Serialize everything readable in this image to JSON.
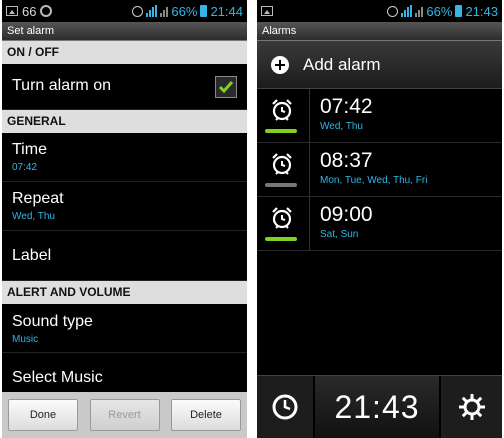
{
  "left": {
    "status": {
      "signal_num": "66",
      "battery": "66%",
      "time": "21:44"
    },
    "title": "Set alarm",
    "sections": {
      "on_off": "ON / OFF",
      "general": "GENERAL",
      "alert": "ALERT AND VOLUME"
    },
    "turn_on": {
      "label": "Turn alarm on",
      "checked": true
    },
    "time": {
      "label": "Time",
      "value": "07:42"
    },
    "repeat": {
      "label": "Repeat",
      "value": "Wed, Thu"
    },
    "label": {
      "label": "Label"
    },
    "sound_type": {
      "label": "Sound type",
      "value": "Music"
    },
    "select_music": {
      "label": "Select Music"
    },
    "buttons": {
      "done": "Done",
      "revert": "Revert",
      "delete": "Delete"
    }
  },
  "right": {
    "status": {
      "signal_num": "",
      "battery": "66%",
      "time": "21:43"
    },
    "title": "Alarms",
    "add_label": "Add alarm",
    "alarms": [
      {
        "time": "07:42",
        "days": "Wed, Thu",
        "enabled": true
      },
      {
        "time": "08:37",
        "days": "Mon, Tue, Wed, Thu, Fri",
        "enabled": false
      },
      {
        "time": "09:00",
        "days": "Sat, Sun",
        "enabled": true
      }
    ],
    "bottom_time": "21:43"
  },
  "colors": {
    "accent": "#33b5e5",
    "on": "#7ed321",
    "off": "#777777"
  }
}
